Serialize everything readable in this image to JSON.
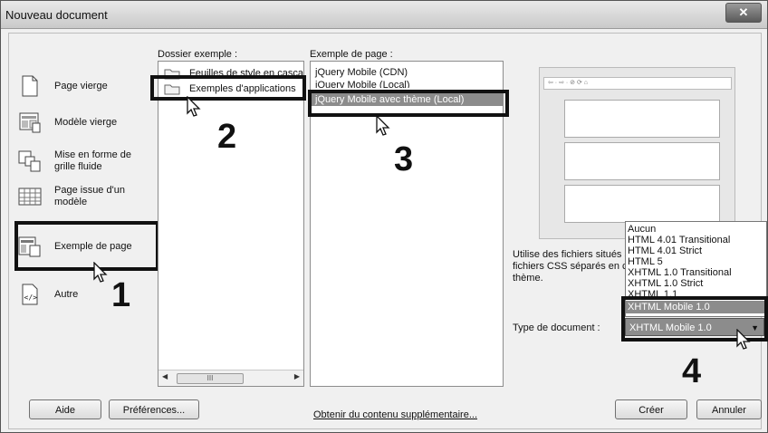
{
  "window": {
    "title": "Nouveau document",
    "close_icon": "close-icon"
  },
  "categories": [
    {
      "label": "Page vierge",
      "icon": "blank-page-icon"
    },
    {
      "label": "Modèle vierge",
      "icon": "blank-template-icon"
    },
    {
      "label": "Mise en forme de\ngrille fluide",
      "icon": "fluid-grid-icon"
    },
    {
      "label": "Page issue d'un\nmodèle",
      "icon": "page-from-template-icon"
    },
    {
      "label": "Exemple de page",
      "icon": "sample-page-icon"
    },
    {
      "label": "Autre",
      "icon": "code-icon"
    }
  ],
  "dossier": {
    "header": "Dossier exemple :",
    "items": [
      "Feuilles de style en casca",
      "Exemples d'applications"
    ],
    "scroll_thumb": "III"
  },
  "exemple": {
    "header": "Exemple de page :",
    "items": [
      "jQuery Mobile (CDN)",
      "jQuery Mobile (Local)",
      "jQuery Mobile avec thème (Local)"
    ]
  },
  "preview": {
    "browser_bar": "⇦ · ⇨ · ⊘ ⟳ ⌂"
  },
  "description": [
    "Utilise des fichiers situés s",
    "fichiers CSS séparés en c",
    "thème."
  ],
  "doctype": {
    "label": "Type de document :",
    "selected": "XHTML Mobile 1.0",
    "options": [
      "Aucun",
      "HTML 4.01 Transitional",
      "HTML 4.01 Strict",
      "HTML 5",
      "XHTML 1.0 Transitional",
      "XHTML 1.0 Strict",
      "XHTML 1.1",
      "XHTML Mobile 1.0"
    ]
  },
  "footer": {
    "aide": "Aide",
    "preferences": "Préférences...",
    "more_content": "Obtenir du contenu supplémentaire...",
    "creer": "Créer",
    "annuler": "Annuler"
  },
  "annotations": {
    "n1": "1",
    "n2": "2",
    "n3": "3",
    "n4": "4"
  },
  "colors": {
    "selection": "#8c8c8c",
    "callout": "#111111"
  }
}
